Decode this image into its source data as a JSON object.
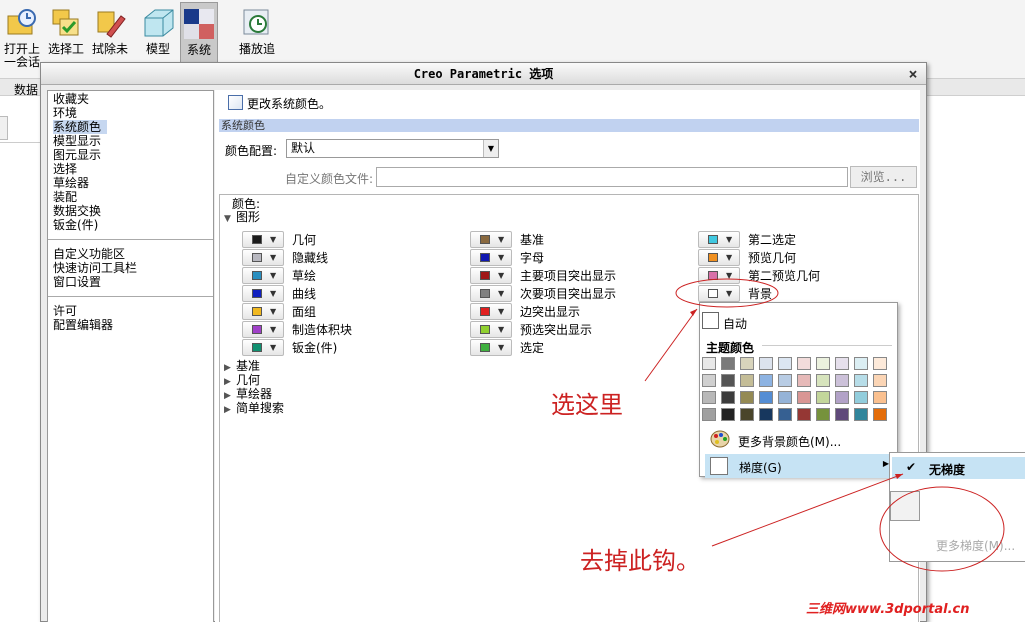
{
  "ribbon": {
    "buttons": [
      {
        "label": "打开上\n一会话",
        "icon": "open-session-icon"
      },
      {
        "label": "选择工",
        "icon": "select-tool-icon"
      },
      {
        "label": "拭除未",
        "icon": "erase-icon"
      },
      {
        "label": "模型",
        "icon": "model-icon"
      },
      {
        "label": "系统",
        "icon": "system-colors-icon",
        "active": true
      },
      {
        "label": "播放追",
        "icon": "playback-icon"
      }
    ],
    "bar_label": "数据"
  },
  "dialog": {
    "title": "Creo Parametric 选项",
    "close": "×"
  },
  "nav": {
    "group1": [
      "收藏夹",
      "环境",
      "系统颜色",
      "模型显示",
      "图元显示",
      "选择",
      "草绘器",
      "装配",
      "数据交换",
      "钣金(件)"
    ],
    "group2": [
      "自定义功能区",
      "快速访问工具栏",
      "窗口设置"
    ],
    "group3": [
      "许可",
      "配置编辑器"
    ],
    "selected": "系统颜色"
  },
  "content": {
    "change_system_colors": "更改系统颜色。",
    "section_title": "系统颜色",
    "color_config_label": "颜色配置:",
    "color_config_value": "默认",
    "custom_file_label": "自定义颜色文件:",
    "browse_button": "浏览...",
    "colors_label": "颜色:",
    "graphics_group": "图形",
    "collapsed_groups": [
      "基准",
      "几何",
      "草绘器",
      "简单搜索"
    ],
    "columns": [
      [
        {
          "label": "几何",
          "color": "#1a1a1a"
        },
        {
          "label": "隐藏线",
          "color": "#b8b8c0"
        },
        {
          "label": "草绘",
          "color": "#2a8fc0"
        },
        {
          "label": "曲线",
          "color": "#1020c0"
        },
        {
          "label": "面组",
          "color": "#f0b820"
        },
        {
          "label": "制造体积块",
          "color": "#a040c8"
        },
        {
          "label": "钣金(件)",
          "color": "#109070"
        }
      ],
      [
        {
          "label": "基准",
          "color": "#8a6a40"
        },
        {
          "label": "字母",
          "color": "#1018b0"
        },
        {
          "label": "主要项目突出显示",
          "color": "#a01818"
        },
        {
          "label": "次要项目突出显示",
          "color": "#808080"
        },
        {
          "label": "边突出显示",
          "color": "#e02020"
        },
        {
          "label": "预选突出显示",
          "color": "#90d030"
        },
        {
          "label": "选定",
          "color": "#40b040"
        }
      ],
      [
        {
          "label": "第二选定",
          "color": "#40c8e0"
        },
        {
          "label": "预览几何",
          "color": "#f09020"
        },
        {
          "label": "第二预览几何",
          "color": "#d870a8"
        },
        {
          "label": "背景",
          "color": "#ffffff"
        }
      ]
    ]
  },
  "popup": {
    "auto_label": "自动",
    "theme_label": "主题颜色",
    "palette": [
      [
        "#e8e8e8",
        "#7a7a7a",
        "#d8d4bc",
        "#dce3ee",
        "#dce6f2",
        "#f2dcdb",
        "#ebf1de",
        "#e6e0ec",
        "#dbeef3",
        "#fdeada"
      ],
      [
        "#d0d0d0",
        "#555555",
        "#c4bd97",
        "#8db3e2",
        "#b8cce4",
        "#e6b9b8",
        "#d7e4bd",
        "#ccc1d9",
        "#b7dde8",
        "#fbd5b5"
      ],
      [
        "#b8b8b8",
        "#3c3c3c",
        "#948a54",
        "#548dd4",
        "#95b3d7",
        "#d99694",
        "#c3d69b",
        "#b2a2c7",
        "#92cddc",
        "#fac08f"
      ],
      [
        "#a0a0a0",
        "#222222",
        "#4a452a",
        "#17375e",
        "#366092",
        "#953734",
        "#76923c",
        "#5f497a",
        "#31859b",
        "#e36c09"
      ]
    ],
    "more_bg_colors": "更多背景颜色(M)...",
    "gradient": "梯度(G)"
  },
  "subpopup": {
    "no_gradient": "无梯度",
    "check": "✔",
    "more_gradient": "更多梯度(M)..."
  },
  "annotations": {
    "choose_here": "选这里",
    "remove_check": "去掉此钩。",
    "watermark": "三维网www.3dportal.cn"
  }
}
